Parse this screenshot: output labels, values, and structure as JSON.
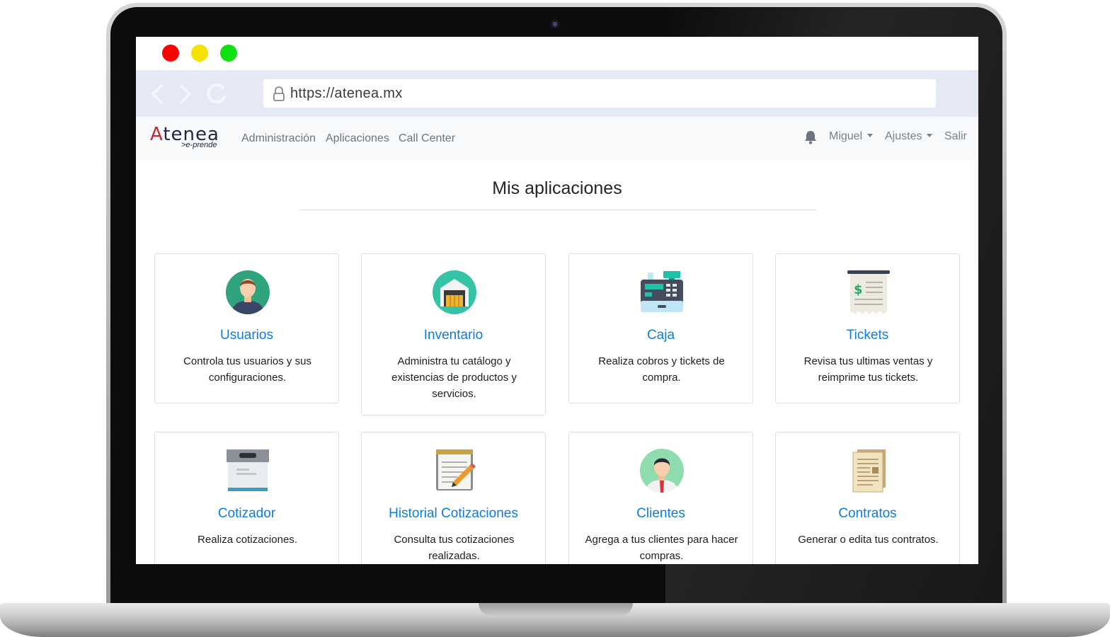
{
  "browser": {
    "url": "https://atenea.mx"
  },
  "navbar": {
    "logo_main": "Atenea",
    "logo_sub": ">e-prende",
    "links": [
      "Administración",
      "Aplicaciones",
      "Call Center"
    ],
    "user": "Miguel",
    "settings": "Ajustes",
    "logout": "Salir"
  },
  "page": {
    "title": "Mis aplicaciones"
  },
  "apps": [
    {
      "name": "Usuarios",
      "description": "Controla tus usuarios y sus configuraciones.",
      "icon": "user-avatar-icon"
    },
    {
      "name": "Inventario",
      "description": "Administra tu catálogo y existencias de productos y servicios.",
      "icon": "warehouse-icon"
    },
    {
      "name": "Caja",
      "description": "Realiza cobros y tickets de compra.",
      "icon": "cash-register-icon"
    },
    {
      "name": "Tickets",
      "description": "Revisa tus ultimas ventas y reimprime tus tickets.",
      "icon": "receipt-icon"
    },
    {
      "name": "Cotizador",
      "description": "Realiza cotizaciones.",
      "icon": "archive-box-icon"
    },
    {
      "name": "Historial Cotizaciones",
      "description": "Consulta tus cotizaciones realizadas.",
      "icon": "notepad-pencil-icon"
    },
    {
      "name": "Clientes",
      "description": "Agrega a tus clientes para hacer compras.",
      "icon": "client-avatar-icon"
    },
    {
      "name": "Contratos",
      "description": "Generar o edita tus contratos.",
      "icon": "contract-document-icon"
    }
  ],
  "colors": {
    "link_blue": "#0d7be0",
    "navbar_bg": "#f8f9fa",
    "urlbar_bg": "#e4e9f5",
    "traffic_red": "#ff0000",
    "traffic_yellow": "#f5e200",
    "traffic_green": "#10e010"
  }
}
